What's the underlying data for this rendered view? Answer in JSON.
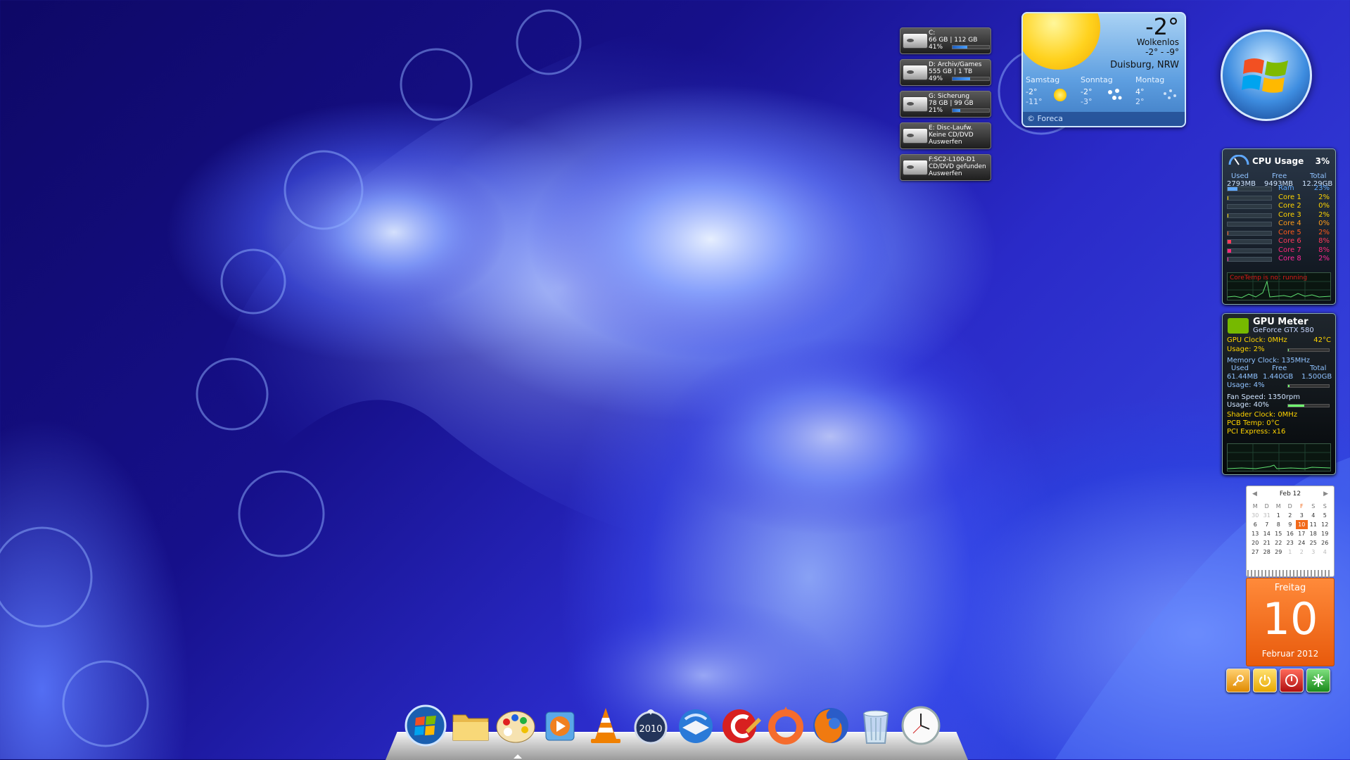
{
  "drives": [
    {
      "line1": "C:",
      "line2": "66 GB | 112 GB",
      "line3": "41%",
      "percent": 41
    },
    {
      "line1": "D: Archiv/Games",
      "line2": "555 GB | 1 TB",
      "line3": "49%",
      "percent": 49
    },
    {
      "line1": "G: Sicherung",
      "line2": "78 GB | 99 GB",
      "line3": "21%",
      "percent": 21
    },
    {
      "line1": "E: Disc-Laufw.",
      "line2": "Keine CD/DVD",
      "line3": "Auswerfen",
      "percent": 0
    },
    {
      "line1": "F:SC2-L100-D1",
      "line2": "CD/DVD gefunden",
      "line3": "Auswerfen",
      "percent": 0
    }
  ],
  "weather": {
    "temp": "-2°",
    "condition": "Wolkenlos",
    "range": "-2° - -9°",
    "city": "Duisburg, NRW",
    "forecast": [
      {
        "day": "Samstag",
        "high": "-2°",
        "low": "-11°",
        "icon": "sun-icon"
      },
      {
        "day": "Sonntag",
        "high": "-2°",
        "low": "-3°",
        "icon": "snow-icon"
      },
      {
        "day": "Montag",
        "high": "4°",
        "low": "2°",
        "icon": "snow-icon"
      }
    ],
    "source": "© Foreca"
  },
  "cpu": {
    "title": "CPU Usage",
    "percent": "3%",
    "headers": {
      "used": "Used",
      "free": "Free",
      "total": "Total"
    },
    "values": {
      "used": "2793MB",
      "free": "9493MB",
      "total": "12.29GB"
    },
    "rows": [
      {
        "label": "Ram",
        "value": "23%",
        "percent": 23,
        "color": "#5fa8ff"
      },
      {
        "label": "Core 1",
        "value": "2%",
        "percent": 2,
        "color": "#ffd400"
      },
      {
        "label": "Core 2",
        "value": "0%",
        "percent": 0,
        "color": "#ffd400"
      },
      {
        "label": "Core 3",
        "value": "2%",
        "percent": 2,
        "color": "#ffd400"
      },
      {
        "label": "Core 4",
        "value": "0%",
        "percent": 0,
        "color": "#ff9c1a"
      },
      {
        "label": "Core 5",
        "value": "2%",
        "percent": 2,
        "color": "#ff5a1a"
      },
      {
        "label": "Core 6",
        "value": "8%",
        "percent": 8,
        "color": "#ff3a5a"
      },
      {
        "label": "Core 7",
        "value": "8%",
        "percent": 8,
        "color": "#ff2a7a"
      },
      {
        "label": "Core 8",
        "value": "2%",
        "percent": 2,
        "color": "#ff2a9a"
      }
    ],
    "warning": "CoreTemp is not running"
  },
  "gpu": {
    "title": "GPU Meter",
    "model": "GeForce GTX 580",
    "gpu_clock": "GPU Clock: 0MHz",
    "temp": "42°C",
    "gpu_usage": "Usage: 2%",
    "gpu_usage_percent": 2,
    "memory_clock": "Memory Clock: 135MHz",
    "headers": {
      "used": "Used",
      "free": "Free",
      "total": "Total"
    },
    "values": {
      "used": "61.44MB",
      "free": "1.440GB",
      "total": "1.500GB"
    },
    "mem_usage": "Usage: 4%",
    "mem_usage_percent": 4,
    "fan_speed": "Fan Speed: 1350rpm",
    "fan_usage": "Usage: 40%",
    "fan_usage_percent": 40,
    "shader_clock": "Shader Clock: 0MHz",
    "pcb_temp": "PCB Temp: 0°C",
    "pci": "PCI Express: x16"
  },
  "calendar": {
    "month": "Feb 12",
    "weekdays": [
      "M",
      "D",
      "M",
      "D",
      "F",
      "S",
      "S"
    ],
    "weeks": [
      [
        {
          "d": "30",
          "dim": true
        },
        {
          "d": "31",
          "dim": true
        },
        {
          "d": "1"
        },
        {
          "d": "2"
        },
        {
          "d": "3"
        },
        {
          "d": "4"
        },
        {
          "d": "5"
        }
      ],
      [
        {
          "d": "6"
        },
        {
          "d": "7"
        },
        {
          "d": "8"
        },
        {
          "d": "9"
        },
        {
          "d": "10",
          "today": true
        },
        {
          "d": "11"
        },
        {
          "d": "12"
        }
      ],
      [
        {
          "d": "13"
        },
        {
          "d": "14"
        },
        {
          "d": "15"
        },
        {
          "d": "16"
        },
        {
          "d": "17"
        },
        {
          "d": "18"
        },
        {
          "d": "19"
        }
      ],
      [
        {
          "d": "20"
        },
        {
          "d": "21"
        },
        {
          "d": "22"
        },
        {
          "d": "23"
        },
        {
          "d": "24"
        },
        {
          "d": "25"
        },
        {
          "d": "26"
        }
      ],
      [
        {
          "d": "27"
        },
        {
          "d": "28"
        },
        {
          "d": "29"
        },
        {
          "d": "1",
          "dim": true
        },
        {
          "d": "2",
          "dim": true
        },
        {
          "d": "3",
          "dim": true
        },
        {
          "d": "4",
          "dim": true
        }
      ]
    ],
    "day_name": "Freitag",
    "day_number": "10",
    "footer": "Februar 2012"
  },
  "power_buttons": [
    {
      "icon": "key-icon",
      "color": "#f0a020"
    },
    {
      "icon": "power-icon",
      "color": "#f5b800"
    },
    {
      "icon": "shutdown-icon",
      "color": "#d02020"
    },
    {
      "icon": "restart-icon",
      "color": "#30b030"
    }
  ],
  "dock": [
    {
      "icon": "windows-start-icon"
    },
    {
      "icon": "folder-icon"
    },
    {
      "icon": "paint-palette-icon"
    },
    {
      "icon": "media-player-icon"
    },
    {
      "icon": "vlc-cone-icon"
    },
    {
      "icon": "nero-2010-icon",
      "label": "2010"
    },
    {
      "icon": "thunderbird-icon"
    },
    {
      "icon": "ccleaner-icon"
    },
    {
      "icon": "origin-icon"
    },
    {
      "icon": "firefox-icon"
    },
    {
      "icon": "recycle-bin-icon"
    },
    {
      "icon": "clock-icon"
    }
  ]
}
